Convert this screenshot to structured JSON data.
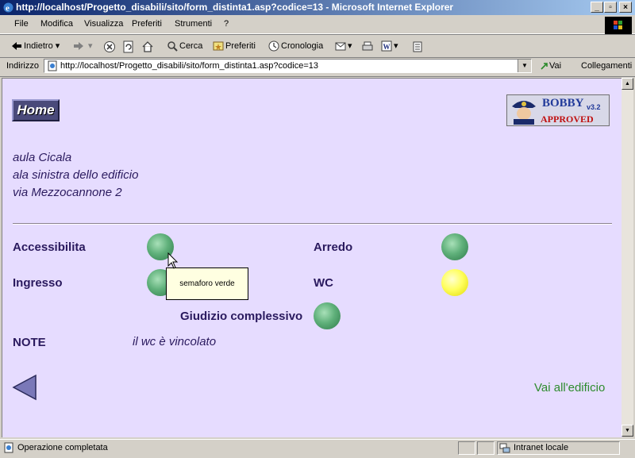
{
  "window": {
    "title": "http://localhost/Progetto_disabili/sito/form_distinta1.asp?codice=13 - Microsoft Internet Explorer"
  },
  "menu": [
    "File",
    "Modifica",
    "Visualizza",
    "Preferiti",
    "Strumenti",
    "?"
  ],
  "toolbar": {
    "back": "Indietro",
    "search": "Cerca",
    "favorites": "Preferiti",
    "history": "Cronologia"
  },
  "address": {
    "label": "Indirizzo",
    "url": "http://localhost/Progetto_disabili/sito/form_distinta1.asp?codice=13",
    "go": "Vai",
    "links": "Collegamenti"
  },
  "page": {
    "home_label": "Home",
    "bobby": {
      "name": "BOBBY",
      "version": "v3.2",
      "status": "APPROVED"
    },
    "location_lines": [
      "aula Cicala",
      "ala sinistra dello edificio",
      "via Mezzocannone 2"
    ],
    "ratings": [
      {
        "label": "Accessibilita",
        "light": "green"
      },
      {
        "label": "Arredo",
        "light": "green"
      },
      {
        "label": "Ingresso",
        "light": "green"
      },
      {
        "label": "WC",
        "light": "yellow"
      }
    ],
    "overall": {
      "label": "Giudizio complessivo",
      "light": "green"
    },
    "tooltip": "semaforo verde",
    "note_label": "NOTE",
    "note_value": "il wc è vincolato",
    "building_link": "Vai all'edificio"
  },
  "status": {
    "text": "Operazione completata",
    "zone": "Intranet locale"
  },
  "colors": {
    "page_background": "#e6dcff",
    "text": "#2a1a5e",
    "link": "#2e8b2e",
    "light_green": "#5fb07a",
    "light_yellow": "#ffff60"
  }
}
